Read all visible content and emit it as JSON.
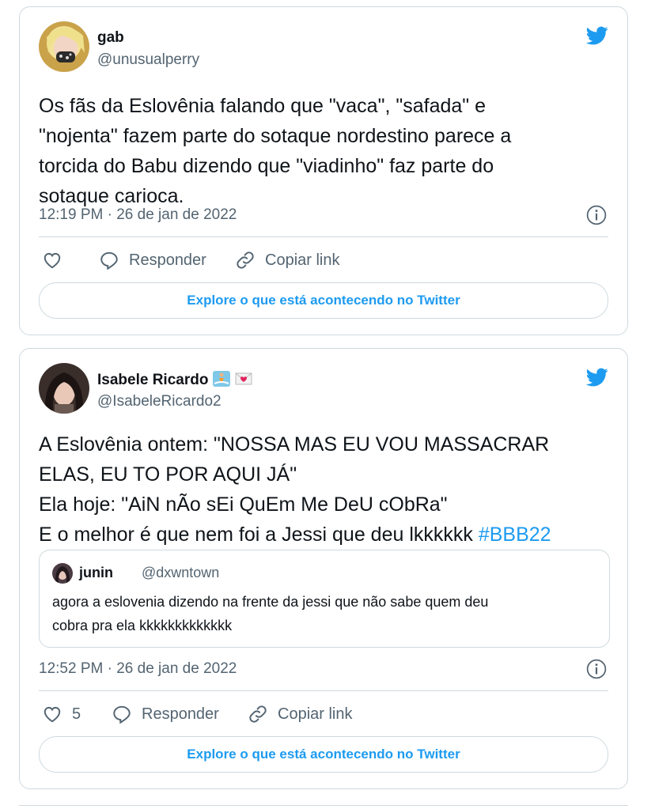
{
  "colors": {
    "accent": "#1d9bf0",
    "muted": "#536471",
    "border": "#cfd9de",
    "text": "#0f1419"
  },
  "tweets": [
    {
      "name": "gab",
      "handle": "@unusualperry",
      "text_lines": [
        "Os fãs da Eslovênia falando que \"vaca\", \"safada\" e",
        "\"nojenta\" fazem parte do sotaque nordestino parece a",
        "torcida do Babu dizendo que \"viadinho\" faz parte do",
        "sotaque carioca."
      ],
      "timestamp": "12:19 PM · 26 de jan de 2022",
      "likes": "",
      "reply_label": "Responder",
      "copy_label": "Copiar link",
      "explore_label": "Explore o que está acontecendo no Twitter",
      "icons": [
        "twitter-bird-icon",
        "info-icon",
        "heart-icon",
        "reply-icon",
        "link-icon"
      ]
    },
    {
      "name": "Isabele Ricardo",
      "handle": "@IsabeleRicardo2",
      "name_badges": [
        "surfer-emoji",
        "love-letter-emoji"
      ],
      "text_lines": [
        "A Eslovênia ontem: \"NOSSA MAS EU VOU MASSACRAR",
        "ELAS, EU TO POR AQUI JÁ\"",
        "Ela hoje: \"AiN nÃo sEi QuEm Me DeU cObRa\"",
        "E o melhor é que nem foi a Jessi que deu lkkkkkk "
      ],
      "hashtag": "#BBB22",
      "quote": {
        "name": "junin",
        "handle": "@dxwntown",
        "text_lines": [
          "agora a eslovenia dizendo na frente da jessi que não sabe quem deu",
          "cobra pra ela kkkkkkkkkkkkk"
        ]
      },
      "timestamp": "12:52 PM · 26 de jan de 2022",
      "likes": "5",
      "reply_label": "Responder",
      "copy_label": "Copiar link",
      "explore_label": "Explore o que está acontecendo no Twitter",
      "icons": [
        "twitter-bird-icon",
        "info-icon",
        "heart-icon",
        "reply-icon",
        "link-icon"
      ]
    }
  ]
}
